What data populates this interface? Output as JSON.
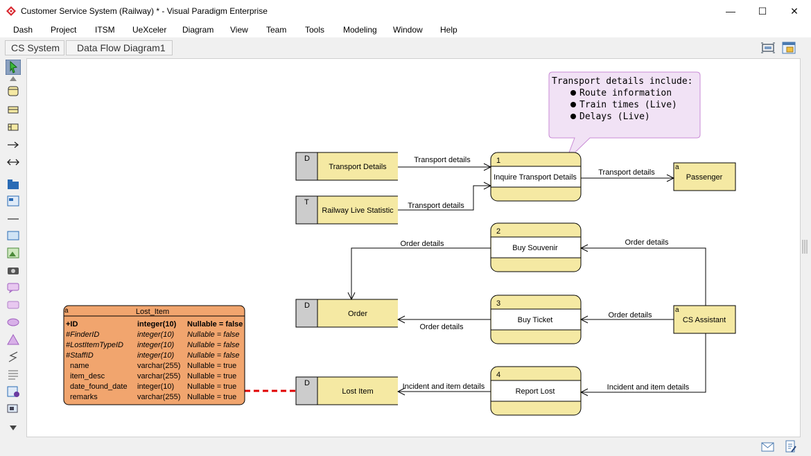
{
  "window": {
    "title": "Customer Service System (Railway) * - Visual Paradigm Enterprise",
    "minimize": "—",
    "maximize": "☐",
    "close": "✕"
  },
  "menu": [
    "Dash",
    "Project",
    "ITSM",
    "UeXceler",
    "Diagram",
    "View",
    "Team",
    "Tools",
    "Modeling",
    "Window",
    "Help"
  ],
  "breadcrumb": [
    "CS System",
    "Data Flow Diagram1"
  ],
  "colors": {
    "process_fill": "#f5e9a3",
    "process_stroke": "#000000",
    "store_id_fill": "#cccccc",
    "note_fill": "#f1e2f5",
    "note_stroke": "#c98bd6",
    "entity_fill": "#f1a56e",
    "connector": "#e00000"
  },
  "diagram": {
    "note": {
      "title": "Transport details include:",
      "bullets": [
        "Route information",
        "Train times (Live)",
        "Delays (Live)"
      ]
    },
    "stores": {
      "transport": {
        "id": "D",
        "name": "Transport Details"
      },
      "railway": {
        "id": "T",
        "name": "Railway Live Statistic"
      },
      "order": {
        "id": "D",
        "name": "Order"
      },
      "lost": {
        "id": "D",
        "name": "Lost Item"
      }
    },
    "processes": {
      "p1": {
        "id": "1",
        "name": "Inquire Transport Details"
      },
      "p2": {
        "id": "2",
        "name": "Buy Souvenir"
      },
      "p3": {
        "id": "3",
        "name": "Buy Ticket"
      },
      "p4": {
        "id": "4",
        "name": "Report Lost"
      }
    },
    "entities": {
      "passenger": {
        "marker": "a",
        "name": "Passenger"
      },
      "assistant": {
        "marker": "a",
        "name": "CS Assistant"
      }
    },
    "flows": {
      "f_transport": "Transport details",
      "f_railway": "Transport details",
      "f_passenger": "Transport details",
      "f_souvenir_order": "Order details",
      "f_assistant_souvenir": "Order details",
      "f_ticket_order": "Order details",
      "f_assistant_ticket": "Order details",
      "f_report_lost": "Incident and item details",
      "f_assistant_report": "Incident and item details"
    },
    "erd": {
      "marker": "a",
      "name": "Lost_Item",
      "columns": [
        {
          "name": "+ID",
          "type": "integer(10)",
          "null": "Nullable = false",
          "style": "bold"
        },
        {
          "name": "#FinderID",
          "type": "integer(10)",
          "null": "Nullable = false",
          "style": "italic"
        },
        {
          "name": "#LostItemTypeID",
          "type": "integer(10)",
          "null": "Nullable = false",
          "style": "italic"
        },
        {
          "name": "#StaffID",
          "type": "integer(10)",
          "null": "Nullable = false",
          "style": "italic"
        },
        {
          "name": "name",
          "type": "varchar(255)",
          "null": "Nullable = true",
          "style": "normal"
        },
        {
          "name": "item_desc",
          "type": "varchar(255)",
          "null": "Nullable = true",
          "style": "normal"
        },
        {
          "name": "date_found_date",
          "type": "integer(10)",
          "null": "Nullable = true",
          "style": "normal"
        },
        {
          "name": "remarks",
          "type": "varchar(255)",
          "null": "Nullable = true",
          "style": "normal"
        }
      ]
    }
  }
}
